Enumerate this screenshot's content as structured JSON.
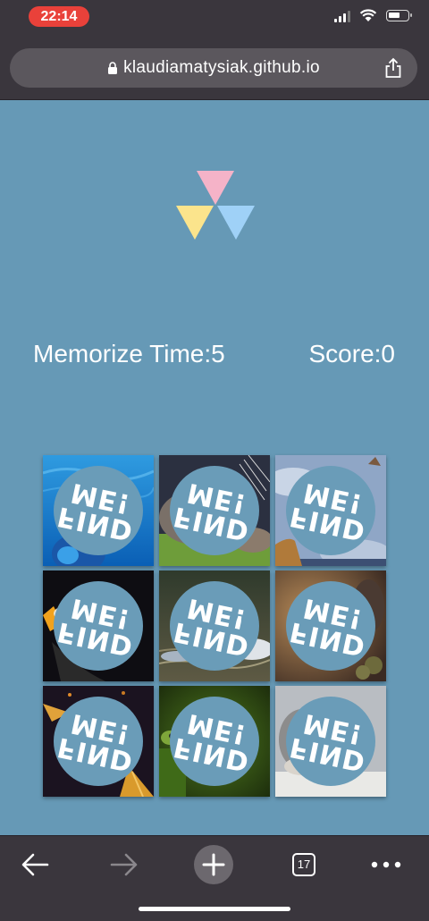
{
  "status_bar": {
    "time": "22:14"
  },
  "browser": {
    "url": "klaudiamatysiak.github.io",
    "tab_count": "17"
  },
  "game": {
    "memorize_label": "Memorize Time:5",
    "score_label": "Score:0",
    "card_overlay_line1": "FIND",
    "card_overlay_line2": "ME!",
    "cards": [
      {
        "image": "blue-fish"
      },
      {
        "image": "cat-whiskers"
      },
      {
        "image": "giraffe-sky"
      },
      {
        "image": "toucan"
      },
      {
        "image": "swan-water"
      },
      {
        "image": "kitten"
      },
      {
        "image": "hummingbird"
      },
      {
        "image": "frog-green"
      },
      {
        "image": "hedgehog"
      }
    ]
  },
  "colors": {
    "background": "#6699b6",
    "logo_pink": "#f5b3c8",
    "logo_yellow": "#fbe48c",
    "logo_blue": "#9fd1f7",
    "chrome": "#3a363d"
  }
}
